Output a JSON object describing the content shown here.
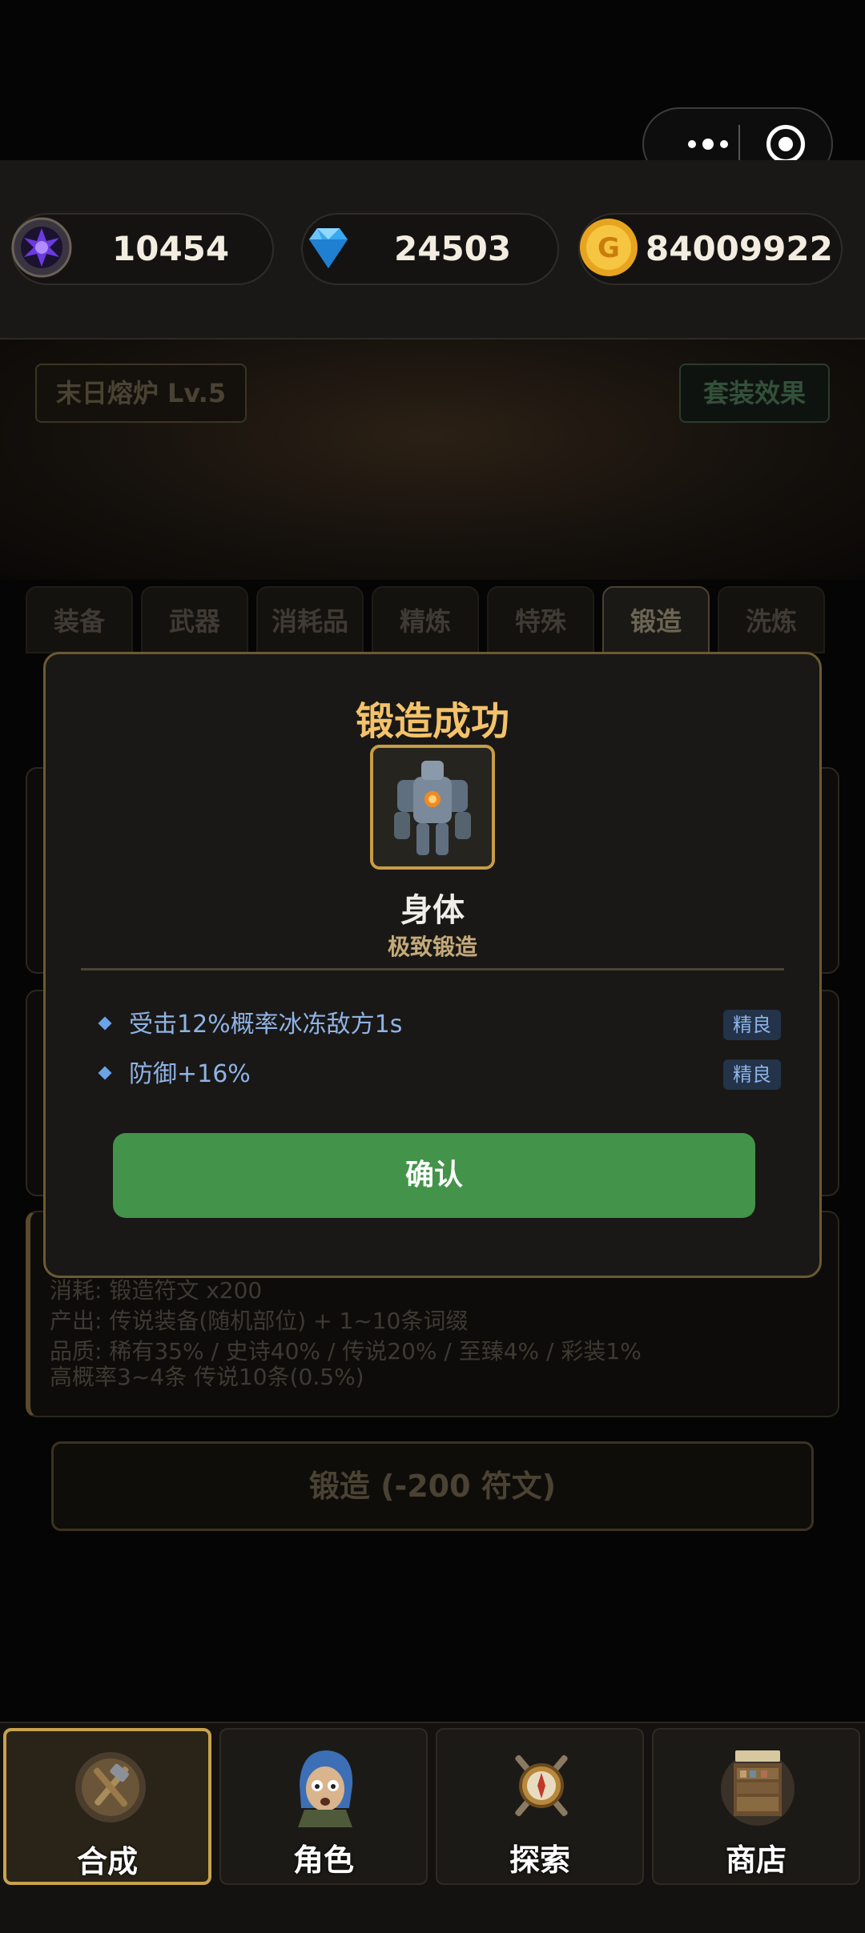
{
  "currency": [
    {
      "name": "purple-gem",
      "value": "10454"
    },
    {
      "name": "diamond",
      "value": "24503"
    },
    {
      "name": "gold-coin",
      "value": "84009922"
    }
  ],
  "header": {
    "furnace_label": "末日熔炉 Lv.5",
    "set_effect_label": "套装效果"
  },
  "tabs": [
    {
      "label": "装备"
    },
    {
      "label": "武器"
    },
    {
      "label": "消耗品"
    },
    {
      "label": "精炼"
    },
    {
      "label": "特殊"
    },
    {
      "label": "锻造",
      "active": true
    },
    {
      "label": "洗炼"
    }
  ],
  "info": {
    "cost": "消耗: 锻造符文 x200",
    "output": "产出: 传说装备(随机部位) + 1~10条词缀",
    "quality": "品质: 稀有35% / 史诗40% / 传说20% / 至臻4% / 彩装1%",
    "chance": "高概率3~4条  传说10条(0.5%)"
  },
  "forge_button": "锻造 (-200 符文)",
  "modal": {
    "title": "锻造成功",
    "item_name": "身体",
    "item_subtitle": "极致锻造",
    "affixes": [
      {
        "text": "受击12%概率冰冻敌方1s",
        "grade": "精良"
      },
      {
        "text": "防御+16%",
        "grade": "精良"
      }
    ],
    "confirm_label": "确认"
  },
  "nav": [
    {
      "label": "合成",
      "icon": "crafting-icon",
      "active": true
    },
    {
      "label": "角色",
      "icon": "character-icon"
    },
    {
      "label": "探索",
      "icon": "explore-icon"
    },
    {
      "label": "商店",
      "icon": "shop-icon"
    }
  ],
  "colors": {
    "title": "#f3c26a",
    "confirm": "#43934a",
    "affix": "#8fb3e6",
    "gold": "#c8a24d"
  }
}
